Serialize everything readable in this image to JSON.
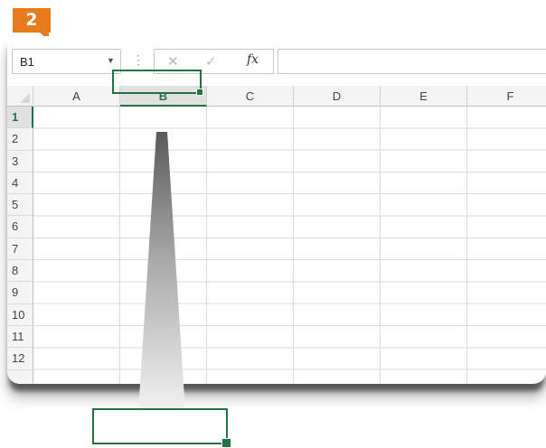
{
  "step": {
    "number": "2",
    "color": "#e67c1e"
  },
  "name_box": {
    "value": "B1"
  },
  "formula_bar": {
    "dots": "⋮",
    "cancel_icon": "✕",
    "enter_icon": "✓",
    "fx_label": "fx",
    "value": ""
  },
  "columns": [
    "A",
    "B",
    "C",
    "D",
    "E",
    "F"
  ],
  "rows": [
    "1",
    "2",
    "3",
    "4",
    "5",
    "6",
    "7",
    "8",
    "9",
    "10",
    "11",
    "12"
  ],
  "selected": {
    "column": "B",
    "row": "1"
  },
  "accent_color": "#217346"
}
